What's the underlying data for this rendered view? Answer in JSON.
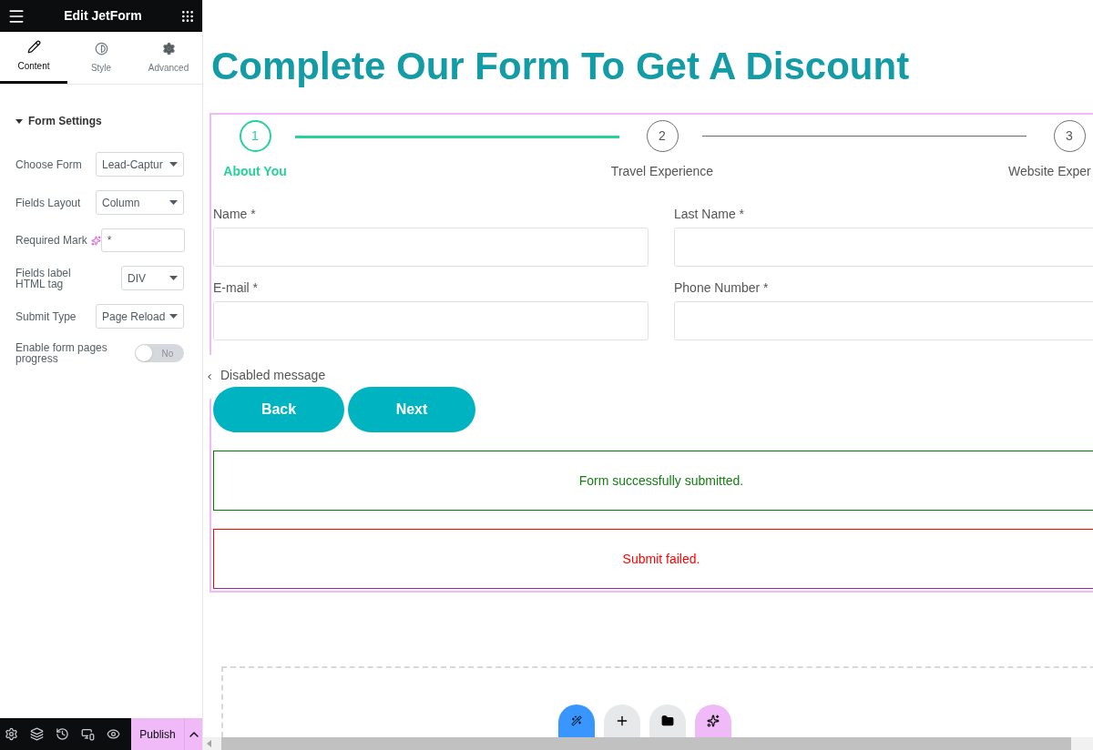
{
  "panel": {
    "title": "Edit JetForm",
    "tabs": [
      {
        "label": "Content",
        "selected": true,
        "kind": "pencil"
      },
      {
        "label": "Style",
        "selected": false,
        "kind": "contrast"
      },
      {
        "label": "Advanced",
        "selected": false,
        "kind": "gear"
      }
    ],
    "section": {
      "title": "Form Settings",
      "expanded": true
    },
    "controls": [
      {
        "kind": "select",
        "label": "Choose Form",
        "value": "Lead-Captur"
      },
      {
        "kind": "select",
        "label": "Fields Layout",
        "value": "Column"
      },
      {
        "kind": "text",
        "label": "Required Mark",
        "value": "*"
      },
      {
        "kind": "select",
        "label": "Fields label HTML tag",
        "value": "DIV"
      },
      {
        "kind": "select",
        "label": "Submit Type",
        "value": "Page Reload"
      },
      {
        "kind": "toggle",
        "label": "Enable form pages progress",
        "on": false,
        "value": "No"
      }
    ],
    "footer": {
      "publish": "Publish"
    }
  },
  "page": {
    "heading": "Complete Our Form To Get A Discount",
    "steps": [
      {
        "number": "1",
        "label": "About You",
        "selected": true
      },
      {
        "number": "2",
        "label": "Travel Experience",
        "selected": false
      },
      {
        "number": "3",
        "label": "Website Exper",
        "selected": false
      }
    ],
    "fields": [
      {
        "label": "Name *"
      },
      {
        "label": "Last Name *"
      },
      {
        "label": "E-mail *"
      },
      {
        "label": "Phone Number *"
      }
    ],
    "disabled_message": "Disabled message",
    "buttons": [
      "Back",
      "Next"
    ],
    "success_message": "Form successfully submitted.",
    "error_message": "Submit failed."
  }
}
